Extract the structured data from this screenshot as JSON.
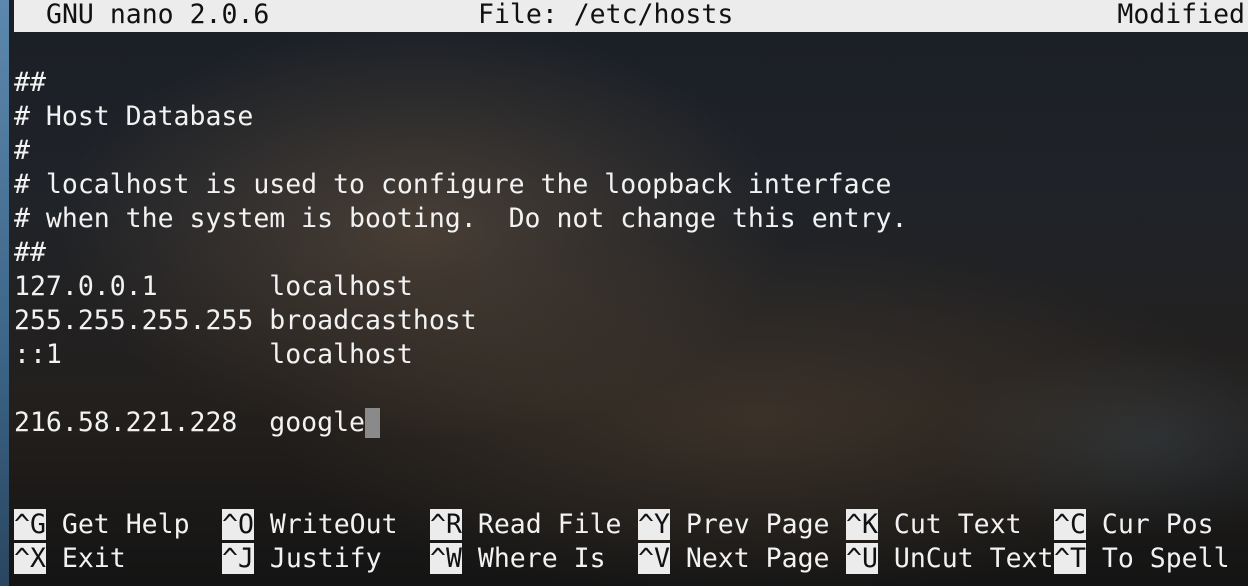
{
  "titlebar": {
    "app_version": "GNU nano 2.0.6",
    "file_label": "File: /etc/hosts",
    "status": "Modified"
  },
  "editor": {
    "lines": [
      "",
      "##",
      "# Host Database",
      "#",
      "# localhost is used to configure the loopback interface",
      "# when the system is booting.  Do not change this entry.",
      "##",
      "127.0.0.1       localhost",
      "255.255.255.255 broadcasthost",
      "::1             localhost",
      "",
      "216.58.221.228  google"
    ]
  },
  "shortcuts": {
    "row1": [
      {
        "key": "^G",
        "label": "Get Help"
      },
      {
        "key": "^O",
        "label": "WriteOut"
      },
      {
        "key": "^R",
        "label": "Read File"
      },
      {
        "key": "^Y",
        "label": "Prev Page"
      },
      {
        "key": "^K",
        "label": "Cut Text"
      },
      {
        "key": "^C",
        "label": "Cur Pos"
      }
    ],
    "row2": [
      {
        "key": "^X",
        "label": "Exit"
      },
      {
        "key": "^J",
        "label": "Justify"
      },
      {
        "key": "^W",
        "label": "Where Is"
      },
      {
        "key": "^V",
        "label": "Next Page"
      },
      {
        "key": "^U",
        "label": "UnCut Text"
      },
      {
        "key": "^T",
        "label": "To Spell"
      }
    ]
  }
}
